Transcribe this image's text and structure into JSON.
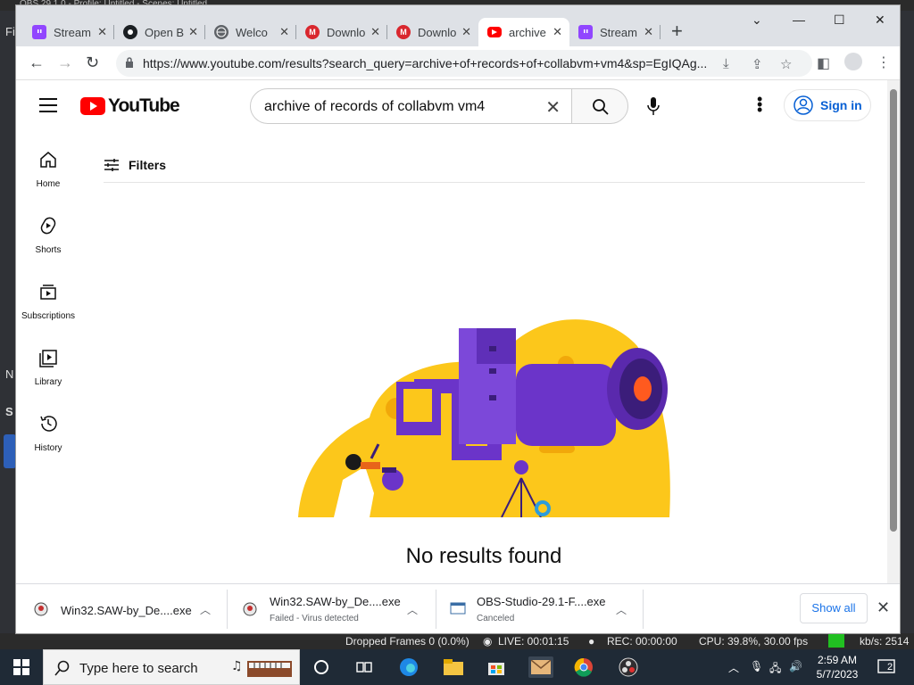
{
  "obs": {
    "title": "OBS 29.1.0 - Profile: Untitled - Scenes: Untitled",
    "status": {
      "dropped_frames": "Dropped Frames 0 (0.0%)",
      "live": "LIVE: 00:01:15",
      "rec": "REC: 00:00:00",
      "cpu": "CPU: 39.8%, 30.00 fps",
      "kbps": "kb/s: 2514"
    }
  },
  "browser": {
    "tabs": [
      {
        "title": "Stream",
        "icon": "twitch-icon",
        "active": false
      },
      {
        "title": "Open B",
        "icon": "github-icon",
        "active": false
      },
      {
        "title": "Welco",
        "icon": "globe-icon",
        "active": false
      },
      {
        "title": "Downlo",
        "icon": "mega-icon",
        "active": false
      },
      {
        "title": "Downlo",
        "icon": "mega-icon",
        "active": false
      },
      {
        "title": "archive",
        "icon": "youtube-icon",
        "active": true
      },
      {
        "title": "Stream",
        "icon": "twitch-icon",
        "active": false
      }
    ],
    "url": "https://www.youtube.com/results?search_query=archive+of+records+of+collabvm+vm4&sp=EgIQAg...",
    "colors": {
      "tabstrip": "#dee1e6",
      "omnibox": "#f1f3f4"
    }
  },
  "youtube": {
    "logo_text": "YouTube",
    "search_value": "archive of records of collabvm vm4",
    "signin_label": "Sign in",
    "sidebar": [
      {
        "label": "Home",
        "icon": "home-icon"
      },
      {
        "label": "Shorts",
        "icon": "shorts-icon"
      },
      {
        "label": "Subscriptions",
        "icon": "subscriptions-icon"
      },
      {
        "label": "Library",
        "icon": "library-icon"
      },
      {
        "label": "History",
        "icon": "history-icon"
      }
    ],
    "filters_label": "Filters",
    "empty_message": "No results found",
    "colors": {
      "brand": "#ff0000",
      "link": "#065fd4"
    }
  },
  "downloads": {
    "items": [
      {
        "name": "Win32.SAW-by_De....exe",
        "status": ""
      },
      {
        "name": "Win32.SAW-by_De....exe",
        "status": "Failed - Virus detected"
      },
      {
        "name": "OBS-Studio-29.1-F....exe",
        "status": "Canceled"
      }
    ],
    "show_all_label": "Show all"
  },
  "taskbar": {
    "search_placeholder": "Type here to search",
    "time": "2:59 AM",
    "date": "5/7/2023",
    "notification_count": "2"
  }
}
